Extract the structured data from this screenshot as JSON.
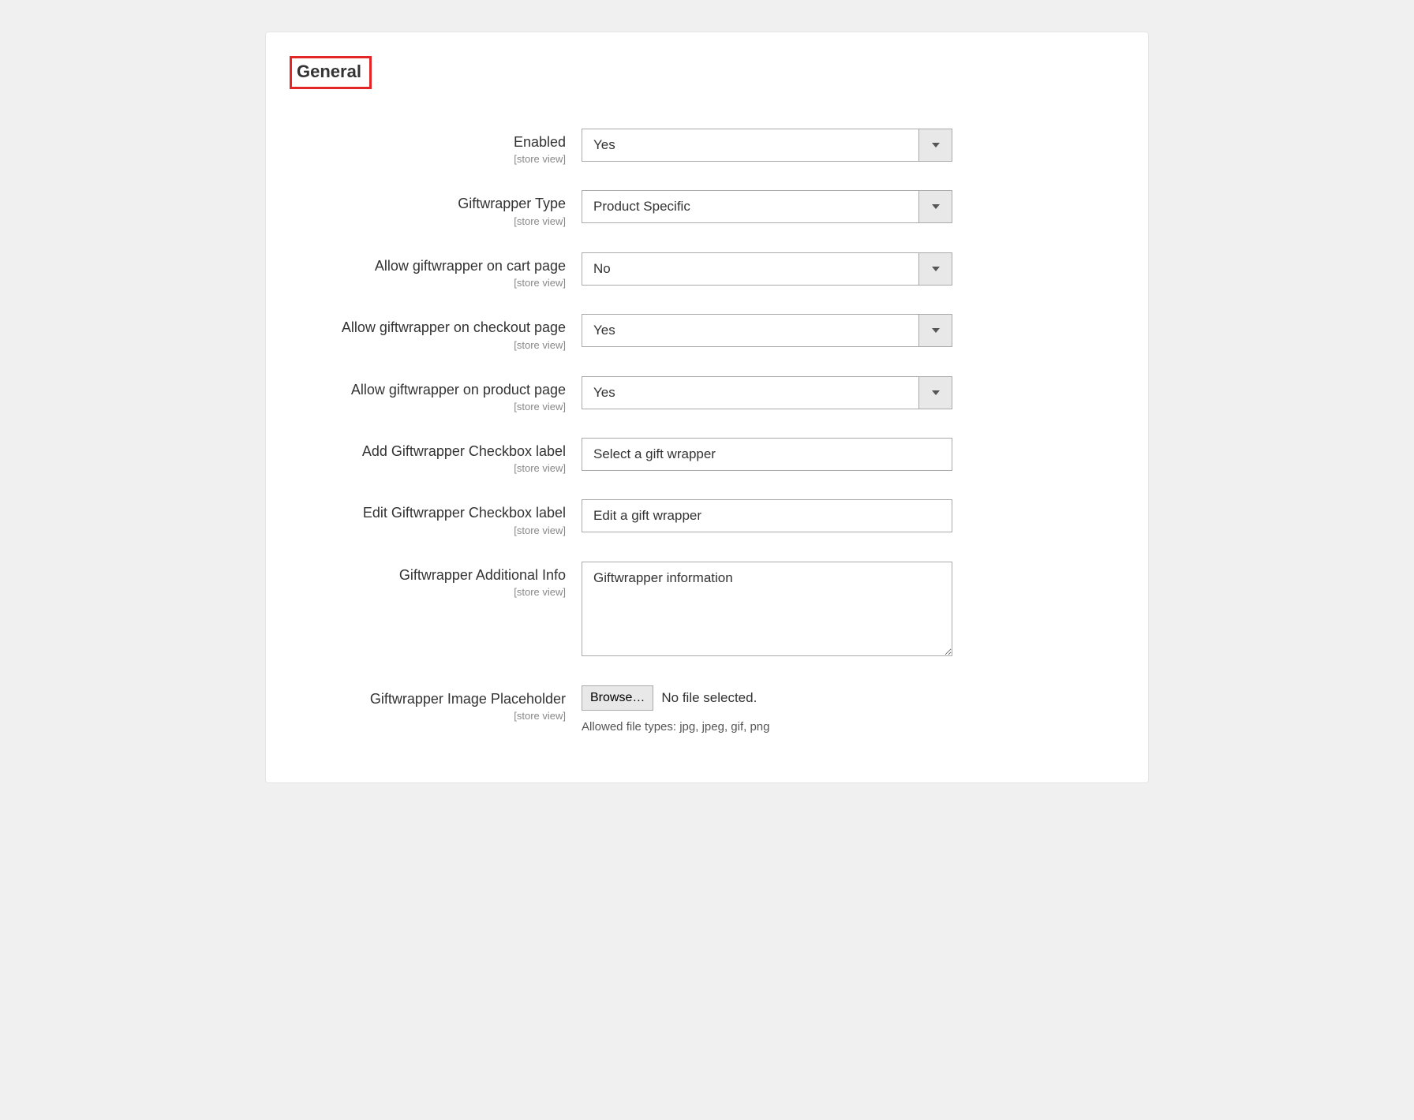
{
  "section": {
    "title": "General",
    "scope_label": "[store view]"
  },
  "fields": {
    "enabled": {
      "label": "Enabled",
      "value": "Yes"
    },
    "giftwrapper_type": {
      "label": "Giftwrapper Type",
      "value": "Product Specific"
    },
    "allow_cart": {
      "label": "Allow giftwrapper on cart page",
      "value": "No"
    },
    "allow_checkout": {
      "label": "Allow giftwrapper on checkout page",
      "value": "Yes"
    },
    "allow_product": {
      "label": "Allow giftwrapper on product page",
      "value": "Yes"
    },
    "add_checkbox_label": {
      "label": "Add Giftwrapper Checkbox label",
      "value": "Select a gift wrapper"
    },
    "edit_checkbox_label": {
      "label": "Edit Giftwrapper Checkbox label",
      "value": "Edit a gift wrapper"
    },
    "additional_info": {
      "label": "Giftwrapper Additional Info",
      "value": "Giftwrapper information"
    },
    "image_placeholder": {
      "label": "Giftwrapper Image Placeholder",
      "browse_button": "Browse…",
      "file_status": "No file selected.",
      "hint": "Allowed file types: jpg, jpeg, gif, png"
    }
  }
}
